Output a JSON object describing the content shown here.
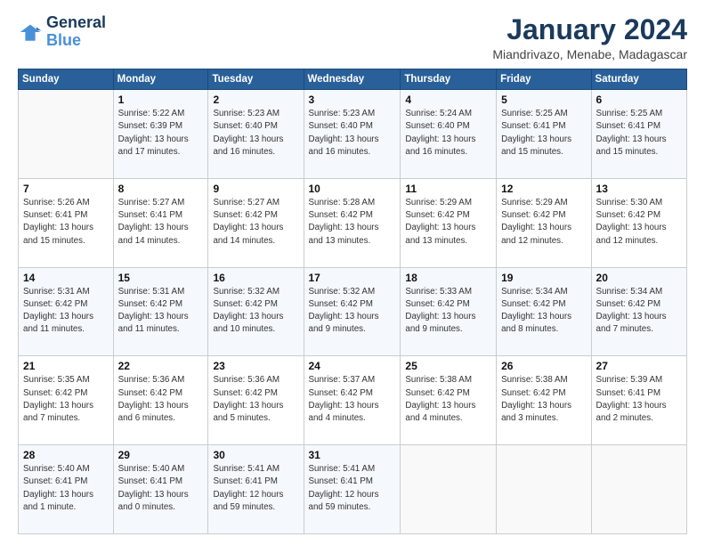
{
  "logo": {
    "blue": "Blue"
  },
  "header": {
    "title": "January 2024",
    "location": "Miandrivazo, Menabe, Madagascar"
  },
  "days": [
    "Sunday",
    "Monday",
    "Tuesday",
    "Wednesday",
    "Thursday",
    "Friday",
    "Saturday"
  ],
  "weeks": [
    [
      {
        "num": "",
        "sunrise": "",
        "sunset": "",
        "daylight": "",
        "daylight2": ""
      },
      {
        "num": "1",
        "sunrise": "Sunrise: 5:22 AM",
        "sunset": "Sunset: 6:39 PM",
        "daylight": "Daylight: 13 hours",
        "daylight2": "and 17 minutes."
      },
      {
        "num": "2",
        "sunrise": "Sunrise: 5:23 AM",
        "sunset": "Sunset: 6:40 PM",
        "daylight": "Daylight: 13 hours",
        "daylight2": "and 16 minutes."
      },
      {
        "num": "3",
        "sunrise": "Sunrise: 5:23 AM",
        "sunset": "Sunset: 6:40 PM",
        "daylight": "Daylight: 13 hours",
        "daylight2": "and 16 minutes."
      },
      {
        "num": "4",
        "sunrise": "Sunrise: 5:24 AM",
        "sunset": "Sunset: 6:40 PM",
        "daylight": "Daylight: 13 hours",
        "daylight2": "and 16 minutes."
      },
      {
        "num": "5",
        "sunrise": "Sunrise: 5:25 AM",
        "sunset": "Sunset: 6:41 PM",
        "daylight": "Daylight: 13 hours",
        "daylight2": "and 15 minutes."
      },
      {
        "num": "6",
        "sunrise": "Sunrise: 5:25 AM",
        "sunset": "Sunset: 6:41 PM",
        "daylight": "Daylight: 13 hours",
        "daylight2": "and 15 minutes."
      }
    ],
    [
      {
        "num": "7",
        "sunrise": "Sunrise: 5:26 AM",
        "sunset": "Sunset: 6:41 PM",
        "daylight": "Daylight: 13 hours",
        "daylight2": "and 15 minutes."
      },
      {
        "num": "8",
        "sunrise": "Sunrise: 5:27 AM",
        "sunset": "Sunset: 6:41 PM",
        "daylight": "Daylight: 13 hours",
        "daylight2": "and 14 minutes."
      },
      {
        "num": "9",
        "sunrise": "Sunrise: 5:27 AM",
        "sunset": "Sunset: 6:42 PM",
        "daylight": "Daylight: 13 hours",
        "daylight2": "and 14 minutes."
      },
      {
        "num": "10",
        "sunrise": "Sunrise: 5:28 AM",
        "sunset": "Sunset: 6:42 PM",
        "daylight": "Daylight: 13 hours",
        "daylight2": "and 13 minutes."
      },
      {
        "num": "11",
        "sunrise": "Sunrise: 5:29 AM",
        "sunset": "Sunset: 6:42 PM",
        "daylight": "Daylight: 13 hours",
        "daylight2": "and 13 minutes."
      },
      {
        "num": "12",
        "sunrise": "Sunrise: 5:29 AM",
        "sunset": "Sunset: 6:42 PM",
        "daylight": "Daylight: 13 hours",
        "daylight2": "and 12 minutes."
      },
      {
        "num": "13",
        "sunrise": "Sunrise: 5:30 AM",
        "sunset": "Sunset: 6:42 PM",
        "daylight": "Daylight: 13 hours",
        "daylight2": "and 12 minutes."
      }
    ],
    [
      {
        "num": "14",
        "sunrise": "Sunrise: 5:31 AM",
        "sunset": "Sunset: 6:42 PM",
        "daylight": "Daylight: 13 hours",
        "daylight2": "and 11 minutes."
      },
      {
        "num": "15",
        "sunrise": "Sunrise: 5:31 AM",
        "sunset": "Sunset: 6:42 PM",
        "daylight": "Daylight: 13 hours",
        "daylight2": "and 11 minutes."
      },
      {
        "num": "16",
        "sunrise": "Sunrise: 5:32 AM",
        "sunset": "Sunset: 6:42 PM",
        "daylight": "Daylight: 13 hours",
        "daylight2": "and 10 minutes."
      },
      {
        "num": "17",
        "sunrise": "Sunrise: 5:32 AM",
        "sunset": "Sunset: 6:42 PM",
        "daylight": "Daylight: 13 hours",
        "daylight2": "and 9 minutes."
      },
      {
        "num": "18",
        "sunrise": "Sunrise: 5:33 AM",
        "sunset": "Sunset: 6:42 PM",
        "daylight": "Daylight: 13 hours",
        "daylight2": "and 9 minutes."
      },
      {
        "num": "19",
        "sunrise": "Sunrise: 5:34 AM",
        "sunset": "Sunset: 6:42 PM",
        "daylight": "Daylight: 13 hours",
        "daylight2": "and 8 minutes."
      },
      {
        "num": "20",
        "sunrise": "Sunrise: 5:34 AM",
        "sunset": "Sunset: 6:42 PM",
        "daylight": "Daylight: 13 hours",
        "daylight2": "and 7 minutes."
      }
    ],
    [
      {
        "num": "21",
        "sunrise": "Sunrise: 5:35 AM",
        "sunset": "Sunset: 6:42 PM",
        "daylight": "Daylight: 13 hours",
        "daylight2": "and 7 minutes."
      },
      {
        "num": "22",
        "sunrise": "Sunrise: 5:36 AM",
        "sunset": "Sunset: 6:42 PM",
        "daylight": "Daylight: 13 hours",
        "daylight2": "and 6 minutes."
      },
      {
        "num": "23",
        "sunrise": "Sunrise: 5:36 AM",
        "sunset": "Sunset: 6:42 PM",
        "daylight": "Daylight: 13 hours",
        "daylight2": "and 5 minutes."
      },
      {
        "num": "24",
        "sunrise": "Sunrise: 5:37 AM",
        "sunset": "Sunset: 6:42 PM",
        "daylight": "Daylight: 13 hours",
        "daylight2": "and 4 minutes."
      },
      {
        "num": "25",
        "sunrise": "Sunrise: 5:38 AM",
        "sunset": "Sunset: 6:42 PM",
        "daylight": "Daylight: 13 hours",
        "daylight2": "and 4 minutes."
      },
      {
        "num": "26",
        "sunrise": "Sunrise: 5:38 AM",
        "sunset": "Sunset: 6:42 PM",
        "daylight": "Daylight: 13 hours",
        "daylight2": "and 3 minutes."
      },
      {
        "num": "27",
        "sunrise": "Sunrise: 5:39 AM",
        "sunset": "Sunset: 6:41 PM",
        "daylight": "Daylight: 13 hours",
        "daylight2": "and 2 minutes."
      }
    ],
    [
      {
        "num": "28",
        "sunrise": "Sunrise: 5:40 AM",
        "sunset": "Sunset: 6:41 PM",
        "daylight": "Daylight: 13 hours",
        "daylight2": "and 1 minute."
      },
      {
        "num": "29",
        "sunrise": "Sunrise: 5:40 AM",
        "sunset": "Sunset: 6:41 PM",
        "daylight": "Daylight: 13 hours",
        "daylight2": "and 0 minutes."
      },
      {
        "num": "30",
        "sunrise": "Sunrise: 5:41 AM",
        "sunset": "Sunset: 6:41 PM",
        "daylight": "Daylight: 12 hours",
        "daylight2": "and 59 minutes."
      },
      {
        "num": "31",
        "sunrise": "Sunrise: 5:41 AM",
        "sunset": "Sunset: 6:41 PM",
        "daylight": "Daylight: 12 hours",
        "daylight2": "and 59 minutes."
      },
      {
        "num": "",
        "sunrise": "",
        "sunset": "",
        "daylight": "",
        "daylight2": ""
      },
      {
        "num": "",
        "sunrise": "",
        "sunset": "",
        "daylight": "",
        "daylight2": ""
      },
      {
        "num": "",
        "sunrise": "",
        "sunset": "",
        "daylight": "",
        "daylight2": ""
      }
    ]
  ]
}
